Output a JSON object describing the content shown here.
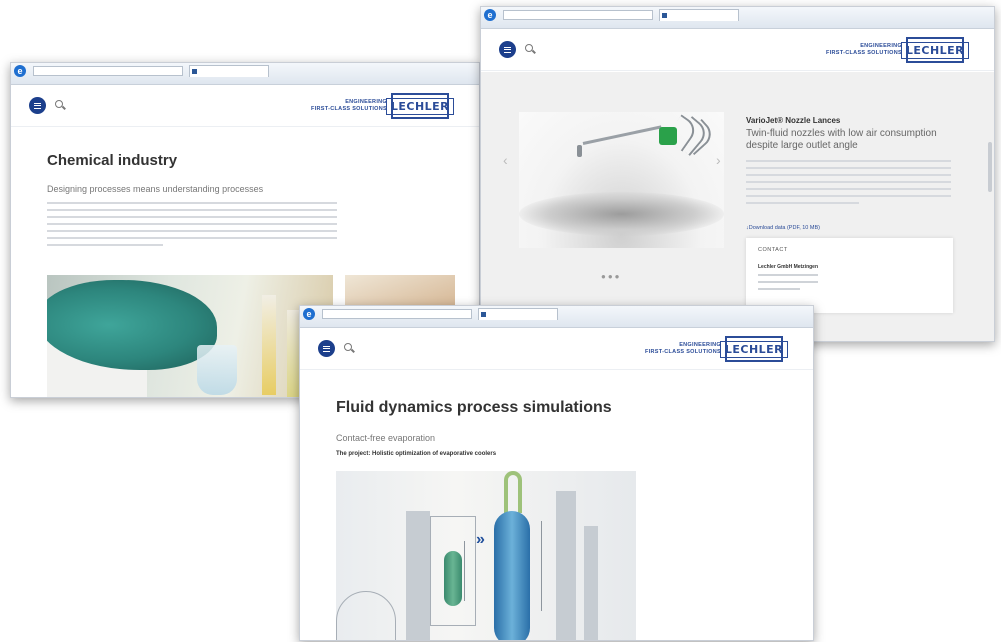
{
  "colors": {
    "brand_blue": "#2b4c98",
    "menu_circle": "#1c3f8c",
    "glove_teal": "#2d867d",
    "nozzle_green": "#2aa14a"
  },
  "brand": {
    "tagline_line1": "ENGINEERING",
    "tagline_line2": "FIRST-CLASS SOLUTIONS",
    "logo_text": "LECHLER"
  },
  "windows": {
    "chemical": {
      "page_title": "Chemical industry",
      "subtitle": "Designing processes means understanding processes"
    },
    "lance": {
      "product_title": "VarioJet® Nozzle Lances",
      "product_subtitle": "Twin-fluid nozzles with low air consumption despite large outlet angle",
      "download_link": "Download data (PDF, 10 MB)",
      "contact_label": "CONTACT",
      "contact_name": "Lechler GmbH Metzingen"
    },
    "fluid": {
      "page_title": "Fluid dynamics process simulations",
      "subtitle": "Contact-free evaporation",
      "project_text": "The project: Holistic optimization of evaporative coolers"
    }
  }
}
